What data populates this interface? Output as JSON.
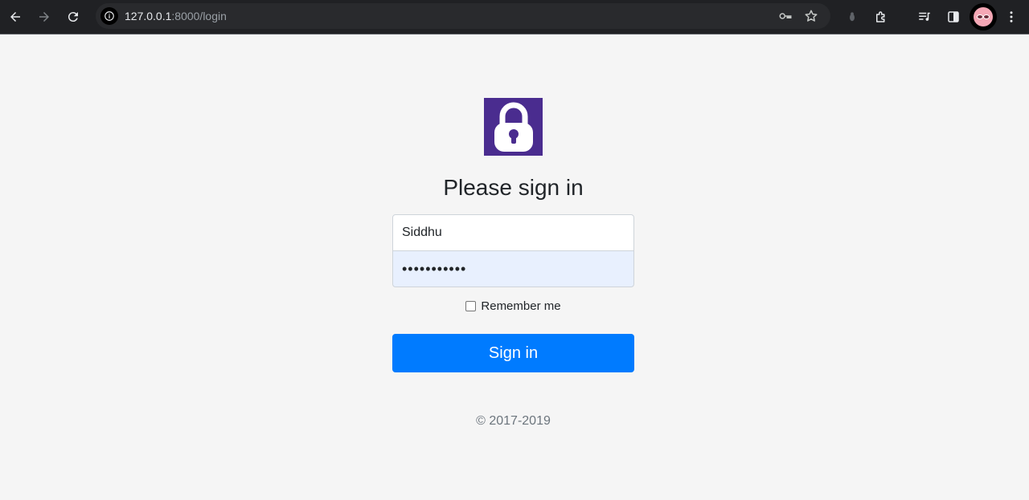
{
  "browser": {
    "url_host": "127.0.0.1",
    "url_rest": ":8000/login",
    "icons": {
      "back": "back-arrow-icon",
      "forward": "forward-arrow-icon",
      "reload": "reload-icon",
      "info": "info-icon",
      "password": "key-icon",
      "bookmark": "star-icon",
      "extension_bug": "bug-icon",
      "extensions": "puzzle-icon",
      "media": "media-queue-icon",
      "sidepanel": "side-panel-icon",
      "menu": "kebab-menu-icon"
    }
  },
  "login": {
    "logo_icon": "lock-icon",
    "heading": "Please sign in",
    "username_value": "Siddhu",
    "password_value": "•••••••••••",
    "remember_label": "Remember me",
    "submit_label": "Sign in",
    "copyright": "© 2017-2019",
    "colors": {
      "logo_bg": "#4a2c8f",
      "button_bg": "#007bff",
      "autofill_bg": "#e8f0fe"
    }
  }
}
